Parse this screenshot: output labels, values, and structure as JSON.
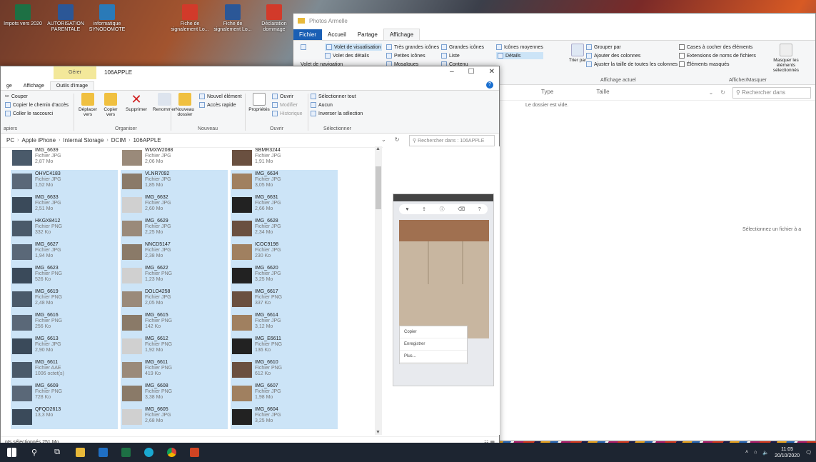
{
  "desktop": {
    "icons": [
      {
        "label": "Impots vers 2020",
        "kind": "excel"
      },
      {
        "label": "AUTORISATION PARENTALE",
        "kind": "word"
      },
      {
        "label": "informatique SYNODOMOTE",
        "kind": "net"
      },
      {
        "label": "Fiche de signalement Lo...",
        "kind": "pdf"
      },
      {
        "label": "Fiche de signalement Lo...",
        "kind": "word"
      },
      {
        "label": "Déclaration dommage",
        "kind": "pdf"
      }
    ]
  },
  "back_window": {
    "title": "Photos Armelle",
    "tabs": [
      "Fichier",
      "Accueil",
      "Partage",
      "Affichage"
    ],
    "ribbon": {
      "volet_visualisation": "Volet de visualisation",
      "volet_navigation": "Volet de navigation",
      "volet_details": "Volet des détails",
      "layouts": [
        "Très grandes icônes",
        "Grandes icônes",
        "Icônes moyennes",
        "Petites icônes",
        "Liste",
        "Détails",
        "Mosaïques",
        "Contenu"
      ],
      "group_by": "Grouper par",
      "add_columns": "Ajouter des colonnes",
      "fit_columns": "Ajuster la taille de toutes les colonnes",
      "sort": "Trier par",
      "current_view_label": "Affichage actuel",
      "checkboxes": [
        "Cases à cocher des éléments",
        "Extensions de noms de fichiers",
        "Éléments masqués"
      ],
      "hide_selected": "Masquer les éléments sélectionnés",
      "show_hide_label": "Afficher/Masquer"
    },
    "search_placeholder": "Rechercher dans",
    "columns": [
      "Type",
      "Taille"
    ],
    "empty_message": "Le dossier est vide.",
    "preview_message": "Sélectionnez un fichier à a"
  },
  "front_window": {
    "manage_tab": "Gérer",
    "title": "106APPLE",
    "ribbon_tabs": [
      "ge",
      "Affichage",
      "Outils d'image"
    ],
    "ribbon": {
      "couper": "Couper",
      "copier_chemin": "Copier le chemin d'accès",
      "coller_raccourci": "Coller le raccourci",
      "presse_papiers": "apiers",
      "deplacer": "Déplacer vers",
      "copier": "Copier vers",
      "supprimer": "Supprimer",
      "renommer": "Renommer",
      "nouveau_dossier": "Nouveau dossier",
      "organiser": "Organiser",
      "nouvel_element": "Nouvel élément",
      "acces_rapide": "Accès rapide",
      "nouveau": "Nouveau",
      "proprietes": "Propriétés",
      "ouvrir": "Ouvrir",
      "modifier": "Modifier",
      "historique": "Historique",
      "ouvrir_group": "Ouvrir",
      "selectionner_tout": "Sélectionner tout",
      "aucun": "Aucun",
      "inverser": "Inverser la sélection",
      "selectionner_group": "Sélectionner"
    },
    "breadcrumb": [
      "PC",
      "Apple iPhone",
      "Internal Storage",
      "DCIM",
      "106APPLE"
    ],
    "search_placeholder": "Rechercher dans : 106APPLE",
    "files": [
      {
        "name": "IMG_6639",
        "type": "Fichier JPG",
        "size": "2,87 Mo",
        "sel": false
      },
      {
        "name": "WMXW2088",
        "type": "Fichier JPG",
        "size": "2,06 Mo",
        "sel": false
      },
      {
        "name": "SBMR3244",
        "type": "Fichier JPG",
        "size": "1,91 Mo",
        "sel": false
      },
      {
        "name": "OHVC4183",
        "type": "Fichier JPG",
        "size": "1,52 Mo",
        "sel": true
      },
      {
        "name": "VLNR7092",
        "type": "Fichier JPG",
        "size": "1,85 Mo",
        "sel": true
      },
      {
        "name": "IMG_6634",
        "type": "Fichier JPG",
        "size": "3,05 Mo",
        "sel": true
      },
      {
        "name": "IMG_6633",
        "type": "Fichier JPG",
        "size": "2,51 Mo",
        "sel": true
      },
      {
        "name": "IMG_6632",
        "type": "Fichier JPG",
        "size": "2,60 Mo",
        "sel": true
      },
      {
        "name": "IMG_6631",
        "type": "Fichier JPG",
        "size": "2,66 Mo",
        "sel": true
      },
      {
        "name": "HKGX8412",
        "type": "Fichier PNG",
        "size": "332 Ko",
        "sel": true
      },
      {
        "name": "IMG_6629",
        "type": "Fichier JPG",
        "size": "2,25 Mo",
        "sel": true
      },
      {
        "name": "IMG_6628",
        "type": "Fichier JPG",
        "size": "2,34 Mo",
        "sel": true
      },
      {
        "name": "IMG_6627",
        "type": "Fichier JPG",
        "size": "1,94 Mo",
        "sel": true
      },
      {
        "name": "NNCD5147",
        "type": "Fichier JPG",
        "size": "2,38 Mo",
        "sel": true
      },
      {
        "name": "ICOC9198",
        "type": "Fichier JPG",
        "size": "230 Ko",
        "sel": true
      },
      {
        "name": "IMG_6623",
        "type": "Fichier PNG",
        "size": "526 Ko",
        "sel": true
      },
      {
        "name": "IMG_6622",
        "type": "Fichier PNG",
        "size": "1,23 Mo",
        "sel": true
      },
      {
        "name": "IMG_6620",
        "type": "Fichier JPG",
        "size": "3,25 Mo",
        "sel": true
      },
      {
        "name": "IMG_6619",
        "type": "Fichier PNG",
        "size": "2,48 Mo",
        "sel": true
      },
      {
        "name": "DOLO4258",
        "type": "Fichier JPG",
        "size": "2,05 Mo",
        "sel": true
      },
      {
        "name": "IMG_6617",
        "type": "Fichier PNG",
        "size": "337 Ko",
        "sel": true
      },
      {
        "name": "IMG_6616",
        "type": "Fichier PNG",
        "size": "256 Ko",
        "sel": true
      },
      {
        "name": "IMG_6615",
        "type": "Fichier PNG",
        "size": "142 Ko",
        "sel": true
      },
      {
        "name": "IMG_6614",
        "type": "Fichier JPG",
        "size": "3,12 Mo",
        "sel": true
      },
      {
        "name": "IMG_6613",
        "type": "Fichier JPG",
        "size": "2,90 Mo",
        "sel": true
      },
      {
        "name": "IMG_6612",
        "type": "Fichier PNG",
        "size": "1,92 Mo",
        "sel": true
      },
      {
        "name": "IMG_E6611",
        "type": "Fichier PNG",
        "size": "136 Ko",
        "sel": true
      },
      {
        "name": "IMG_6611",
        "type": "Fichier AAE",
        "size": "1006 octet(s)",
        "sel": true
      },
      {
        "name": "IMG_6611",
        "type": "Fichier PNG",
        "size": "419 Ko",
        "sel": true
      },
      {
        "name": "IMG_6610",
        "type": "Fichier PNG",
        "size": "612 Ko",
        "sel": true
      },
      {
        "name": "IMG_6609",
        "type": "Fichier PNG",
        "size": "728 Ko",
        "sel": true
      },
      {
        "name": "IMG_6608",
        "type": "Fichier PNG",
        "size": "3,38 Mo",
        "sel": true
      },
      {
        "name": "IMG_6607",
        "type": "Fichier JPG",
        "size": "1,98 Mo",
        "sel": true
      },
      {
        "name": "QFQO2613",
        "type": "",
        "size": "13,3 Mo",
        "sel": true
      },
      {
        "name": "IMG_6605",
        "type": "Fichier JPG",
        "size": "2,68 Mo",
        "sel": true
      },
      {
        "name": "IMG_6604",
        "type": "Fichier JPG",
        "size": "3,25 Mo",
        "sel": true
      }
    ],
    "preview_menu": [
      "Copier",
      "Enregistrer",
      "Plus..."
    ],
    "status": "nts sélectionnés 251 Mo"
  },
  "taskbar": {
    "time": "11:05",
    "date": "20/10/2020"
  }
}
